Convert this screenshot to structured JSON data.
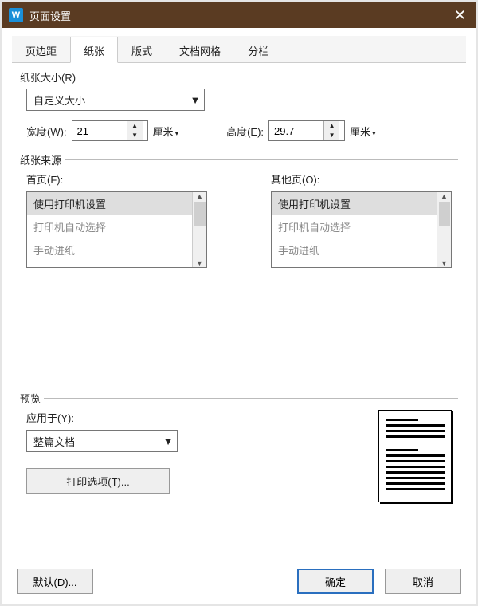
{
  "window": {
    "title": "页面设置"
  },
  "tabs": {
    "items": [
      {
        "label": "页边距"
      },
      {
        "label": "纸张"
      },
      {
        "label": "版式"
      },
      {
        "label": "文档网格"
      },
      {
        "label": "分栏"
      }
    ],
    "active": 1
  },
  "paper_size": {
    "legend": "纸张大小(R)",
    "value": "自定义大小",
    "width_label": "宽度(W):",
    "width_value": "21",
    "height_label": "高度(E):",
    "height_value": "29.7",
    "unit": "厘米"
  },
  "paper_source": {
    "legend": "纸张来源",
    "first_page_label": "首页(F):",
    "other_pages_label": "其他页(O):",
    "options": [
      "使用打印机设置",
      "打印机自动选择",
      "手动进纸"
    ],
    "first_selected": 0,
    "other_selected": 0
  },
  "preview": {
    "legend": "预览",
    "apply_label": "应用于(Y):",
    "apply_value": "整篇文档",
    "print_options": "打印选项(T)..."
  },
  "footer": {
    "default": "默认(D)...",
    "ok": "确定",
    "cancel": "取消"
  }
}
